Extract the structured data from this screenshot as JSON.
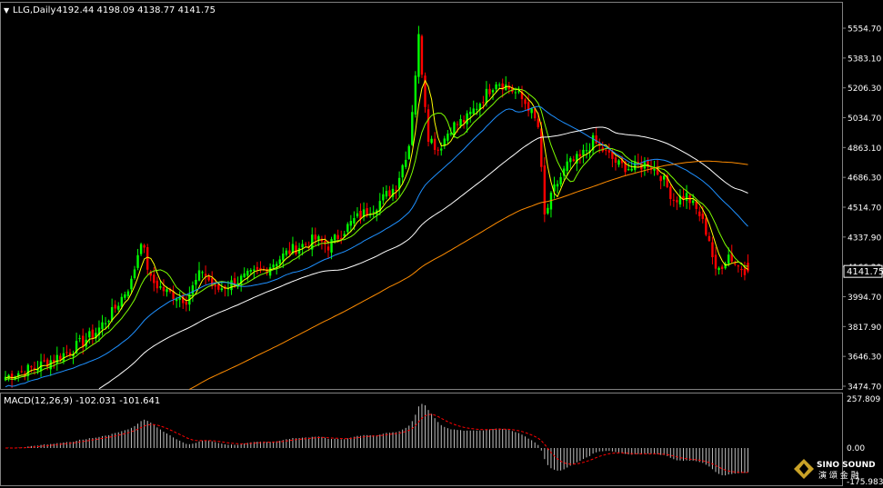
{
  "header": {
    "symbol": "LLG,Daily",
    "ohlc": "4192.44 4198.09 4138.77 4141.75"
  },
  "macd_header": {
    "label": "MACD(12,26,9) -102.031 -101.641"
  },
  "price_axis": {
    "ticks": [
      "5554.70",
      "5383.10",
      "5206.30",
      "5034.70",
      "4863.10",
      "4686.30",
      "4514.70",
      "4337.90",
      "4166.30",
      "3994.70",
      "3817.90",
      "3646.30",
      "3474.70"
    ],
    "current_price_label": "4141.75"
  },
  "macd_axis": {
    "ticks": [
      "257.809",
      "0.00",
      "-175.983"
    ]
  },
  "logo": {
    "line1": "SINO SOUND",
    "line2": "演 頌 金 融"
  },
  "colors": {
    "background": "#000000",
    "bull_candle": "#00ff00",
    "bear_candle": "#ff0000",
    "ma_yellow": "#ffff00",
    "ma_green": "#7cfc00",
    "ma_blue": "#1e90ff",
    "ma_white": "#ffffff",
    "ma_orange": "#ff8c00",
    "macd_hist": "#c0c0c0",
    "macd_signal": "#ff0000"
  },
  "chart_data": {
    "type": "candlestick",
    "ylim": [
      3474.7,
      5690
    ],
    "price_anchors": [
      [
        0,
        3530
      ],
      [
        10,
        3590
      ],
      [
        20,
        3680
      ],
      [
        28,
        3790
      ],
      [
        33,
        3900
      ],
      [
        39,
        4080
      ],
      [
        42,
        4330
      ],
      [
        45,
        4090
      ],
      [
        50,
        4020
      ],
      [
        56,
        3980
      ],
      [
        61,
        4150
      ],
      [
        65,
        4030
      ],
      [
        72,
        4090
      ],
      [
        80,
        4150
      ],
      [
        88,
        4260
      ],
      [
        96,
        4330
      ],
      [
        100,
        4290
      ],
      [
        108,
        4440
      ],
      [
        115,
        4530
      ],
      [
        121,
        4640
      ],
      [
        125,
        4880
      ],
      [
        128,
        5500
      ],
      [
        131,
        4930
      ],
      [
        134,
        4850
      ],
      [
        138,
        4980
      ],
      [
        143,
        5030
      ],
      [
        148,
        5150
      ],
      [
        152,
        5250
      ],
      [
        155,
        5220
      ],
      [
        158,
        5180
      ],
      [
        162,
        5100
      ],
      [
        165,
        4980
      ],
      [
        167,
        4460
      ],
      [
        170,
        4620
      ],
      [
        174,
        4760
      ],
      [
        178,
        4800
      ],
      [
        182,
        4900
      ],
      [
        186,
        4830
      ],
      [
        190,
        4760
      ],
      [
        194,
        4740
      ],
      [
        199,
        4770
      ],
      [
        203,
        4700
      ],
      [
        207,
        4560
      ],
      [
        211,
        4580
      ],
      [
        215,
        4470
      ],
      [
        218,
        4330
      ],
      [
        220,
        4130
      ],
      [
        224,
        4240
      ],
      [
        227,
        4170
      ],
      [
        230,
        4145
      ]
    ],
    "candle_count": 231,
    "moving_averages": [
      {
        "period": 5,
        "color": "#ffff00"
      },
      {
        "period": 10,
        "color": "#7cfc00"
      },
      {
        "period": 30,
        "color": "#1e90ff"
      },
      {
        "period": 60,
        "color": "#ffffff"
      },
      {
        "period": 120,
        "color": "#ff8c00"
      }
    ],
    "macd": {
      "fast": 12,
      "slow": 26,
      "signal": 9,
      "last_value": -102.031,
      "last_signal": -101.641,
      "ylim": [
        -175.983,
        257.809
      ]
    },
    "last_close": 4141.75
  }
}
